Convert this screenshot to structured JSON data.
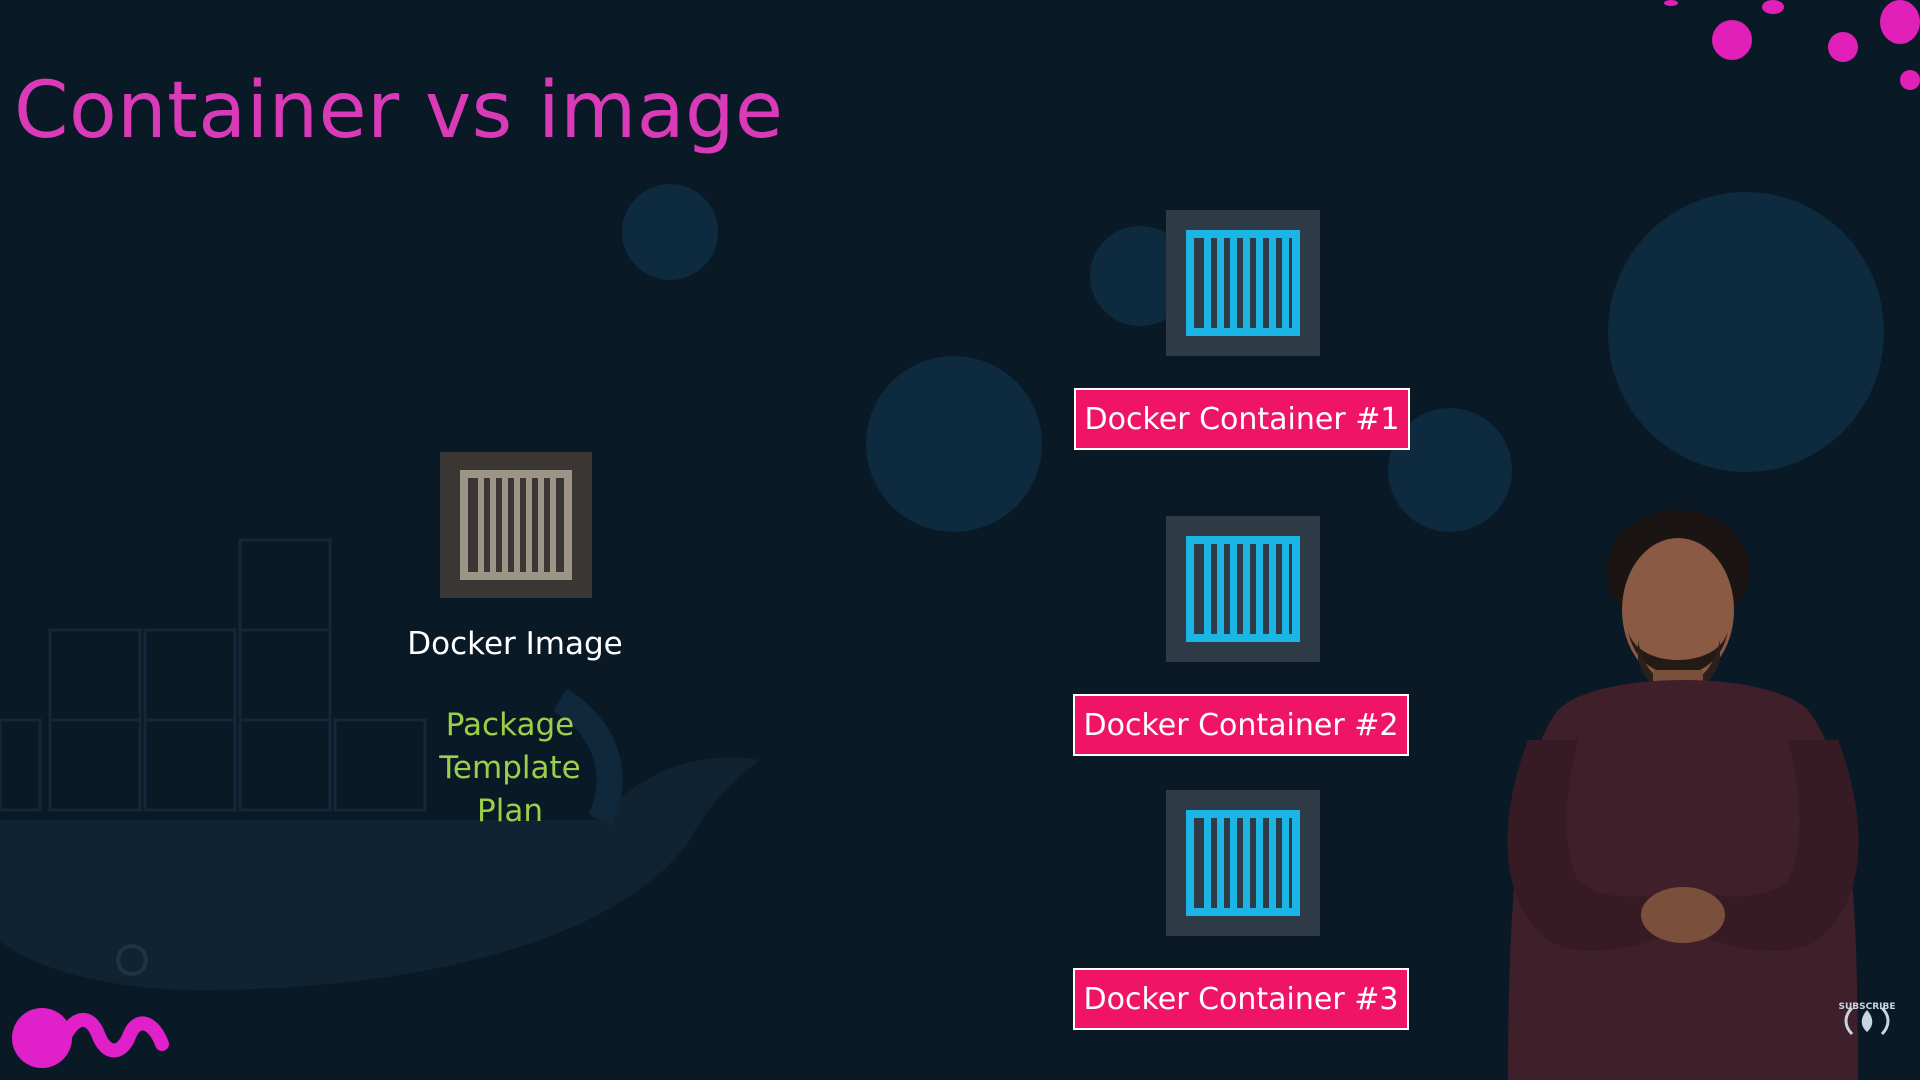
{
  "slide": {
    "title": "Container vs image",
    "background_color": "#0a1926",
    "accent_color": "#d93bb8"
  },
  "image": {
    "label": "Docker Image",
    "words": [
      "Package",
      "Template",
      "Plan"
    ],
    "icon": "shipping-container-icon"
  },
  "containers": [
    {
      "label": "Docker Container #1",
      "icon": "shipping-container-icon"
    },
    {
      "label": "Docker Container #2",
      "icon": "shipping-container-icon"
    },
    {
      "label": "Docker Container #3",
      "icon": "shipping-container-icon"
    }
  ],
  "corner": {
    "subscribe_label": "SUBSCRIBE",
    "icon": "freecodecamp-logo"
  },
  "presenter": {
    "icon": "presenter-figure"
  }
}
